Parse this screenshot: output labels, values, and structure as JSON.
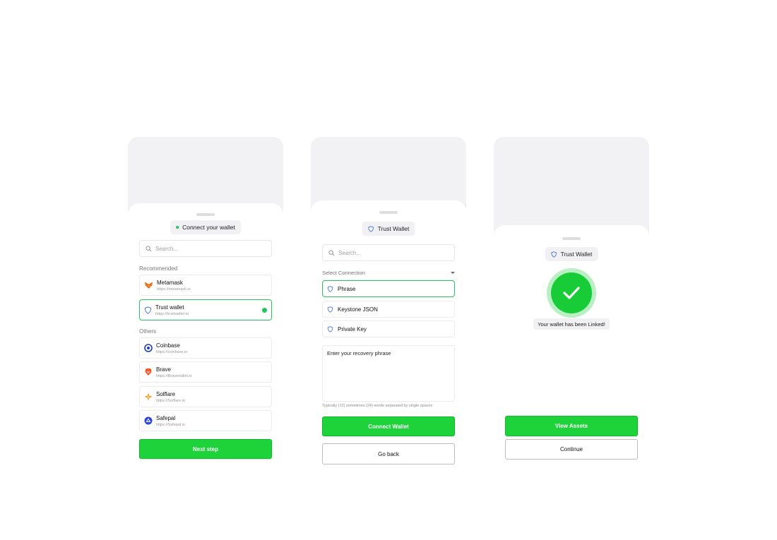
{
  "screen1": {
    "pill": "Connect your wallet",
    "search_placeholder": "Search...",
    "recommended_label": "Recommended",
    "others_label": "Others",
    "recommended": [
      {
        "name": "Metamask",
        "url": "https://metamask.io",
        "icon": "metamask-fox-icon"
      },
      {
        "name": "Trust wallet",
        "url": "https://trustwallet.io",
        "icon": "shield-icon"
      }
    ],
    "others": [
      {
        "name": "Coinbase",
        "url": "https://coinbase.io",
        "icon": "coinbase-icon"
      },
      {
        "name": "Brave",
        "url": "https://Bravewallet.io",
        "icon": "brave-lion-icon"
      },
      {
        "name": "Solflare",
        "url": "https://Solflare.io",
        "icon": "solflare-icon"
      },
      {
        "name": "Safepal",
        "url": "https://Safepal.io",
        "icon": "safepal-icon"
      }
    ],
    "next_button": "Next step"
  },
  "screen2": {
    "pill": "Trust Wallet",
    "search_placeholder": "Search...",
    "select_label": "Select Connection",
    "options": [
      "Phrase",
      "Keystone JSON",
      "Private Key"
    ],
    "phrase_placeholder": "Enter your recovery phrase",
    "hint": "Typically (12) sometimes (24) words separated by single spaces",
    "connect_button": "Connect Wallet",
    "back_button": "Go back"
  },
  "screen3": {
    "pill": "Trust Wallet",
    "message": "Your wallet has been Linked!",
    "view_button": "View Assets",
    "continue_button": "Continue"
  },
  "colors": {
    "accent": "#1ed23a",
    "selected_border": "#22c55e",
    "shield": "#3b6fd8"
  }
}
